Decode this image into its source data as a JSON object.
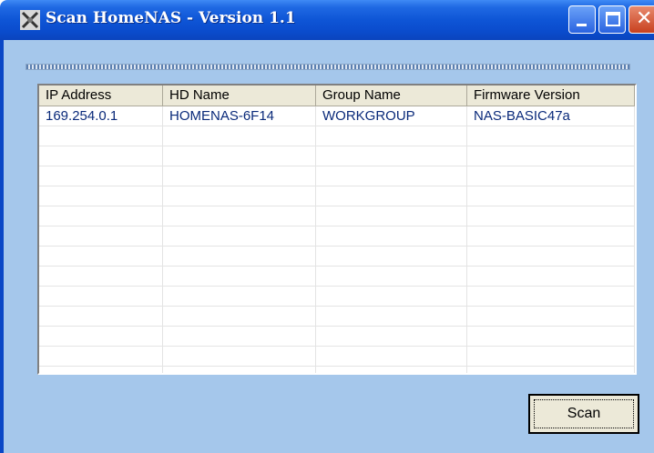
{
  "window": {
    "title": "Scan HomeNAS - Version 1.1",
    "icon": "crossed-tools-icon",
    "buttons": [
      "minimize",
      "maximize",
      "close"
    ]
  },
  "progress": {
    "style": "dotted-marquee"
  },
  "table": {
    "columns": [
      "IP Address",
      "HD Name",
      "Group Name",
      "Firmware Version"
    ],
    "rows": [
      [
        "169.254.0.1",
        "HOMENAS-6F14",
        "WORKGROUP",
        "NAS-BASIC47a"
      ]
    ]
  },
  "scan_button": {
    "label": "Scan"
  },
  "colors": {
    "titlebar": "#0a4bcc",
    "client": "#a5c7eb",
    "row_text": "#0a2a7a"
  }
}
